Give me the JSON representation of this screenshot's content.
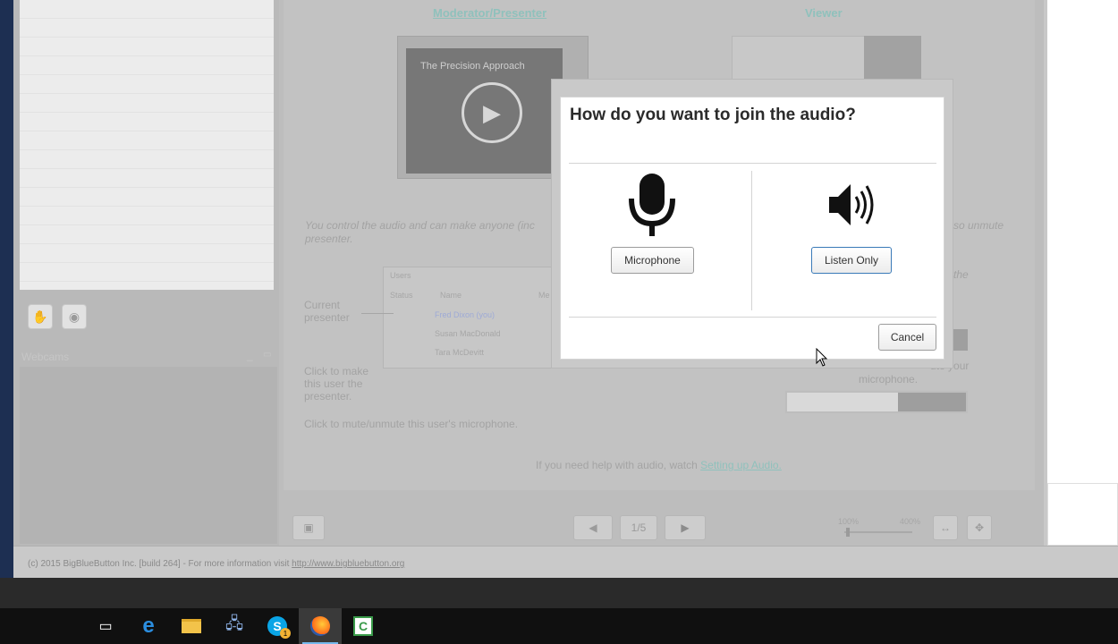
{
  "left": {
    "webcams_title": "Webcams"
  },
  "slide": {
    "moderator_heading": "Moderator/Presenter",
    "viewer_heading": "Viewer",
    "video_title": "The Precision Approach",
    "note_left": "You control the audio and can make anyone (inc",
    "note_left_2": "presenter.",
    "note_right": "so unmute",
    "note_right_2": "the",
    "users_panel": {
      "title": "Users",
      "columns": [
        "Status",
        "Name",
        "Me"
      ],
      "rows": [
        "Fred Dixon (you)",
        "Susan MacDonald",
        "Tara McDevitt"
      ]
    },
    "current_presenter": "Current presenter",
    "click_to_make": "Click to make this user the presenter.",
    "click_to_mute": "Click to mute/unmute this user's microphone.",
    "mute_right": "ute your",
    "microphone_right": "microphone.",
    "help_prefix": "If you need help with audio, watch",
    "help_link": "Setting up Audio."
  },
  "toolbar": {
    "page_indicator": "1/5",
    "zoom_min": "100%",
    "zoom_max": "400%"
  },
  "footer": {
    "text": "(c) 2015 BigBlueButton Inc. [build 264] - For more information visit",
    "link": "http://www.bigbluebutton.org"
  },
  "dialog": {
    "title": "How do you want to join the audio?",
    "microphone_label": "Microphone",
    "listen_only_label": "Listen Only",
    "cancel_label": "Cancel"
  },
  "taskbar": {
    "items": [
      "task-view",
      "edge",
      "file-explorer",
      "network-app",
      "skype",
      "firefox",
      "camtasia"
    ],
    "skype_badge": "1"
  }
}
